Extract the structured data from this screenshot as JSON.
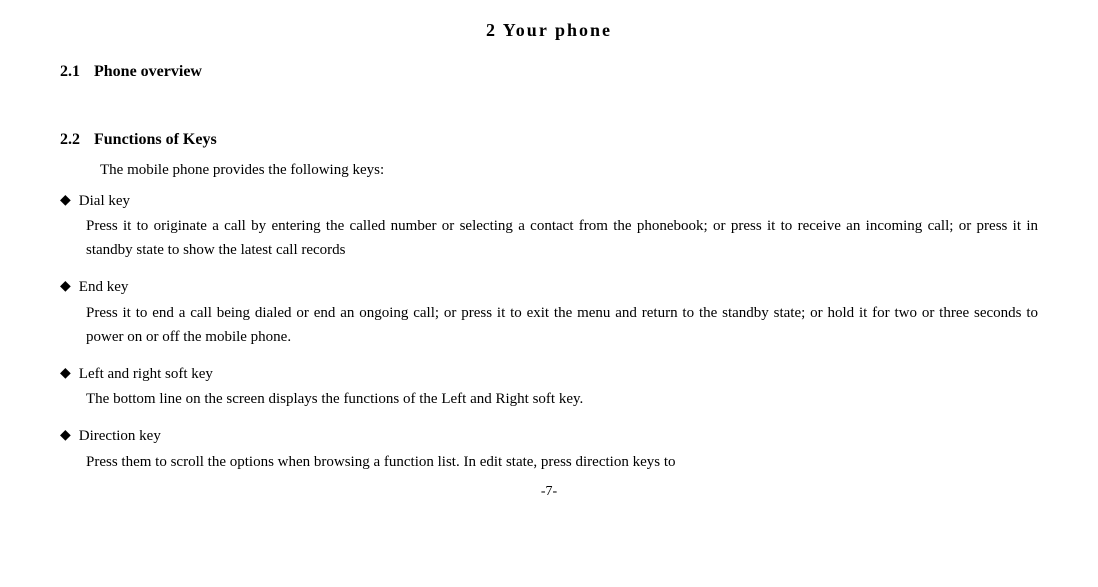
{
  "page": {
    "title": "2   Your  phone",
    "footer": "-7-"
  },
  "section21": {
    "number": "2.1",
    "heading": "Phone overview"
  },
  "section22": {
    "number": "2.2",
    "heading": "Functions of Keys",
    "intro": "The mobile phone provides the following keys:",
    "bullets": [
      {
        "label": "Dial key",
        "description": "Press it to originate a call by entering the called number or selecting a contact from the phonebook; or press it to receive an incoming call; or press it in standby state to show the latest call records"
      },
      {
        "label": "End key",
        "description": "Press it to end a call being dialed or end an ongoing call; or press it to exit the menu and return to the standby state; or hold it for two or three seconds to power on or off the mobile phone."
      },
      {
        "label": "Left and right soft key",
        "description": "The bottom line on the screen displays the functions of the Left and Right soft key."
      },
      {
        "label": "Direction key",
        "description": "Press them to scroll the options when browsing a function list. In edit state, press direction keys to"
      }
    ]
  }
}
